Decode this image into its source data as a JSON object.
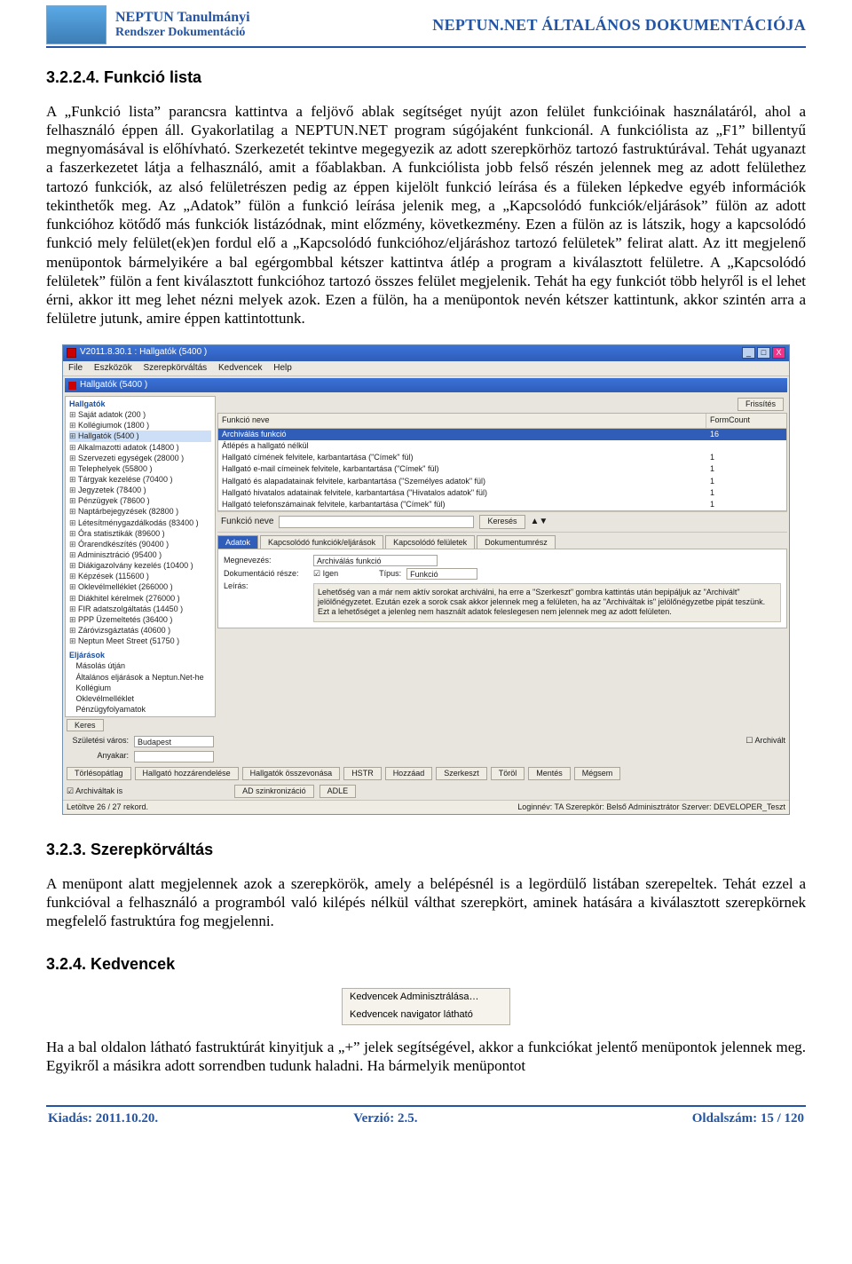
{
  "header": {
    "title_line1": "NEPTUN Tanulmányi",
    "title_line2": "Rendszer Dokumentáció",
    "right": "NEPTUN.NET ÁLTALÁNOS DOKUMENTÁCIÓJA"
  },
  "section1": {
    "num": "3.2.2.4. Funkció lista",
    "para": "A „Funkció lista” parancsra kattintva a feljövő ablak segítséget nyújt azon felület funkcióinak használatáról, ahol a felhasználó éppen áll. Gyakorlatilag a NEPTUN.NET program súgójaként funkcionál. A funkciólista az „F1” billentyű megnyomásával is előhívható. Szerkezetét tekintve megegyezik az adott szerepkörhöz tartozó fastruktúrával. Tehát ugyanazt a faszerkezetet látja a felhasználó, amit a főablakban. A funkciólista jobb felső részén jelennek meg az adott felülethez tartozó funkciók, az alsó felületrészen pedig az éppen kijelölt funkció leírása és a füleken lépkedve egyéb információk tekinthetők meg. Az „Adatok” fülön a funkció leírása jelenik meg, a „Kapcsolódó funkciók/eljárások” fülön az adott funkcióhoz kötődő más funkciók listázódnak, mint előzmény, következmény. Ezen a fülön az is látszik, hogy a kapcsolódó funkció mely felület(ek)en fordul elő a „Kapcsolódó funkcióhoz/eljáráshoz tartozó felületek” felirat alatt. Az itt megjelenő menüpontok bármelyikére a bal egérgombbal kétszer kattintva átlép a program a kiválasztott felületre. A „Kapcsolódó felületek” fülön a fent kiválasztott funkcióhoz tartozó összes felület megjelenik. Tehát ha egy funkciót több helyről is el lehet érni, akkor itt meg lehet nézni melyek azok. Ezen a fülön, ha a menüpontok nevén kétszer kattintunk, akkor szintén arra a felületre jutunk, amire éppen kattintottunk."
  },
  "screenshot": {
    "outer_title": "V2011.8.30.1 : Hallgatók (5400  )",
    "menus": [
      "File",
      "Eszközök",
      "Szerepkörváltás",
      "Kedvencek",
      "Help"
    ],
    "inner_title": "Hallgatók (5400  )",
    "refresh_btn": "Frissítés",
    "tree_root": "Hallgatók",
    "tree_nodes": [
      "Saját adatok (200  )",
      "Kollégiumok (1800  )",
      "Hallgatók (5400  )",
      "Alkalmazotti adatok (14800  )",
      "Szervezeti egységek (28000  )",
      "Telephelyek (55800  )",
      "Tárgyak kezelése (70400  )",
      "Jegyzetek (78400  )",
      "Pénzügyek (78600  )",
      "Naptárbejegyzések (82800  )",
      "Létesítménygazdálkodás (83400  )",
      "Óra statisztikák (89600  )",
      "Órarendkészítés (90400  )",
      "Adminisztráció (95400  )",
      "Diákigazolvány kezelés (10400  )",
      "Képzések (115600  )",
      "Oklevélmelléklet (266000  )",
      "Diákhitel kérelmek (276000  )",
      "FIR adatszolgáltatás (14450  )",
      "PPP Üzemeltetés (36400  )",
      "Záróvizsgáztatás (40600  )",
      "Neptun Meet Street (51750  )"
    ],
    "tree_tasks_label": "Eljárások",
    "tree_tasks": [
      "Másolás útján",
      "Általános eljárások a Neptun.Net-he",
      "Kollégium",
      "Oklevélmelléklet",
      "Pénzügyfolyamatok"
    ],
    "funclist_header1": "Funkció neve",
    "funclist_header2": "FormCount",
    "funclist_rows": [
      {
        "name": "Archiválás funkció",
        "count": "16"
      },
      {
        "name": "Átlépés a hallgató nélkül",
        "count": ""
      },
      {
        "name": "Hallgató címének felvitele, karbantartása (\"Címek\" fül)",
        "count": "1"
      },
      {
        "name": "Hallgató e-mail címeinek felvitele, karbantartása (\"Címek\" fül)",
        "count": "1"
      },
      {
        "name": "Hallgató és alapadatainak felvitele, karbantartása (\"Személyes adatok\" fül)",
        "count": "1"
      },
      {
        "name": "Hallgató hivatalos adatainak felvitele, karbantartása (\"Hivatalos adatok\" fül)",
        "count": "1"
      },
      {
        "name": "Hallgató telefonszámainak felvitele, karbantartása (\"Címek\" fül)",
        "count": "1"
      }
    ],
    "funclist_sel_index": 0,
    "search_label": "Funkció neve",
    "search_btn": "Keresés",
    "tabs": [
      "Adatok",
      "Kapcsolódó funkciók/eljárások",
      "Kapcsolódó felületek",
      "Dokumentumrész"
    ],
    "tab_active": 0,
    "detail_name_lbl": "Megnevezés:",
    "detail_name_val": "Archiválás funkció",
    "detail_doc_lbl": "Dokumentáció része:",
    "detail_doc_chk": "Igen",
    "detail_type_lbl": "Típus:",
    "detail_type_val": "Funkció",
    "detail_desc_lbl": "Leírás:",
    "detail_desc": "Lehetőség van a már nem aktív sorokat archiválni, ha erre a \"Szerkeszt\" gombra kattintás után bepipáljuk az \"Archivált\" jelölőnégyzetet. Ezután ezek a sorok csak akkor jelennek meg a felületen, ha az \"Archiváltak is\" jelölőnégyzetbe pipát teszünk. Ezt a lehetőséget a jelenleg nem használt adatok feleslegesen nem jelennek meg az adott felületen.",
    "kereso_btn": "Keres",
    "form_city_lbl": "Születési város:",
    "form_city_val": "Budapest",
    "form_anyakar_lbl": "Anyakar:",
    "form_archivalt_lbl": "Archivált",
    "bottom_buttons": [
      "Törlésopátlag",
      "Hallgató hozzárendelése",
      "Hallgatók összevonása",
      "HSTR",
      "Hozzáad",
      "Szerkeszt",
      "Töröl",
      "Mentés",
      "Mégsem"
    ],
    "archivaltak_is": "Archiváltak is",
    "ad_sync": "AD szinkronizáció",
    "adle_btn": "ADLE",
    "status_left": "Letöltve 26 / 27 rekord.",
    "status_right": "Loginnév: TA  Szerepkör: Belső Adminisztrátor  Szerver: DEVELOPER_Teszt"
  },
  "section2": {
    "num": "3.2.3. Szerepkörváltás",
    "para": "A menüpont alatt megjelennek azok a szerepkörök, amely a belépésnél is a legördülő listában szerepeltek. Tehát ezzel a funkcióval a felhasználó a programból való kilépés nélkül válthat szerepkört, aminek hatására a kiválasztott szerepkörnek megfelelő fastruktúra fog megjelenni."
  },
  "section3": {
    "num": "3.2.4. Kedvencek",
    "popup": [
      "Kedvencek Adminisztrálása…",
      "Kedvencek navigator látható"
    ],
    "para": "Ha a bal oldalon látható fastruktúrát kinyitjuk a „+” jelek segítségével, akkor a funkciókat jelentő menüpontok jelennek meg. Egyikről a másikra adott sorrendben tudunk haladni. Ha bármelyik menüpontot"
  },
  "footer": {
    "left": "Kiadás: 2011.10.20.",
    "mid": "Verzió: 2.5.",
    "right": "Oldalszám: 15 / 120"
  }
}
